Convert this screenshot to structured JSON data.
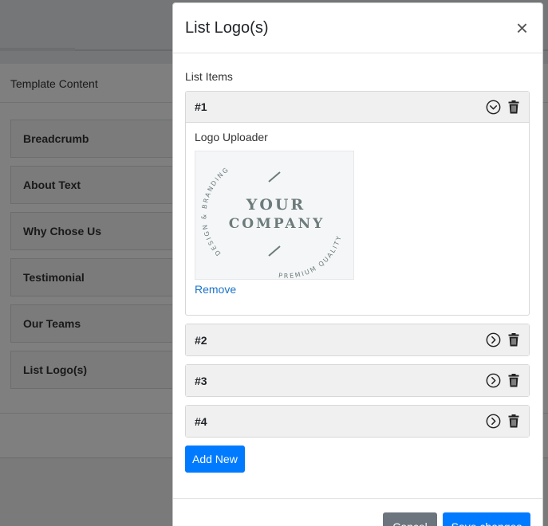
{
  "background": {
    "section_title": "Template Content",
    "items": [
      {
        "label": "Breadcrumb"
      },
      {
        "label": "About Text"
      },
      {
        "label": "Why Chose Us"
      },
      {
        "label": "Testimonial"
      },
      {
        "label": "Our Teams"
      },
      {
        "label": "List Logo(s)"
      }
    ]
  },
  "modal": {
    "title": "List Logo(s)",
    "close_symbol": "×",
    "list_label": "List Items",
    "items": [
      {
        "number": "#1",
        "expanded": true,
        "field_label": "Logo Uploader",
        "logo": {
          "line1": "YOUR",
          "line2": "COMPANY",
          "arc_left": "DESIGN & BRANDING",
          "arc_right": "PREMIUM QUALITY"
        },
        "remove_label": "Remove"
      },
      {
        "number": "#2",
        "expanded": false
      },
      {
        "number": "#3",
        "expanded": false
      },
      {
        "number": "#4",
        "expanded": false
      }
    ],
    "add_new_label": "Add New",
    "cancel_label": "Cancel",
    "save_label": "Save changes"
  },
  "icons": {
    "collapse": "chevron-down-circle-icon",
    "expand": "chevron-right-circle-icon",
    "delete": "trash-icon",
    "close": "close-icon"
  },
  "colors": {
    "primary": "#007bff",
    "secondary": "#6c757d",
    "overlay": "rgba(0,0,0,0.5)",
    "card_header": "#f0f0f0",
    "link": "#1a73c8",
    "logo_text": "#6d7b7a"
  }
}
